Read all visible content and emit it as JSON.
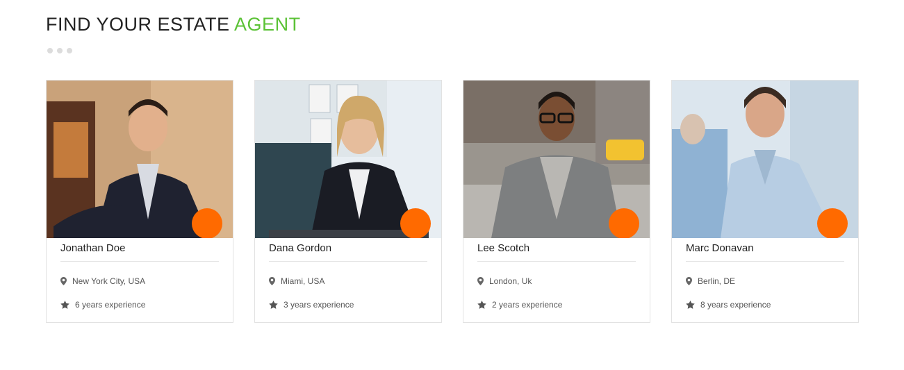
{
  "section": {
    "title_main": "FIND YOUR ESTATE",
    "title_accent": "AGENT",
    "accent_color": "#5bc236",
    "button_color": "#ff6a00"
  },
  "agents": [
    {
      "name": "Jonathan Doe",
      "location": "New York City, USA",
      "experience": "6 years experience"
    },
    {
      "name": "Dana Gordon",
      "location": "Miami, USA",
      "experience": "3 years experience"
    },
    {
      "name": "Lee Scotch",
      "location": "London, Uk",
      "experience": "2 years experience"
    },
    {
      "name": "Marc Donavan",
      "location": "Berlin, DE",
      "experience": "8 years experience"
    }
  ],
  "icons": {
    "location": "map-marker-icon",
    "experience": "star-icon"
  }
}
